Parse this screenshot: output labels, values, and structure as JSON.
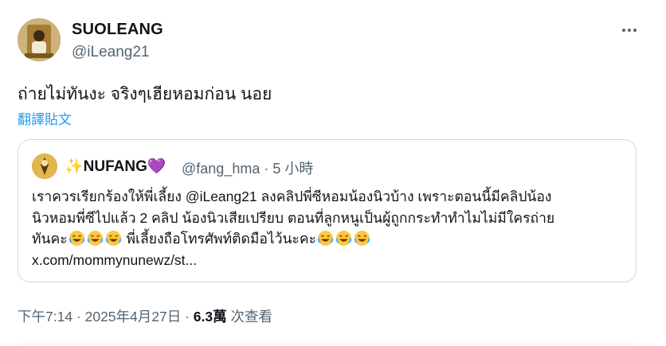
{
  "author": {
    "name": "SUOLEANG",
    "handle": "@iLeang21"
  },
  "tweet": {
    "text": "ถ่ายไม่ทันงะ จริงๆเฮียหอมก่อน นอย",
    "translate_label": "翻譯貼文"
  },
  "quote": {
    "name_prefix": "✨",
    "name": "NUFANG",
    "name_suffix": "💜",
    "handle_time": "@fang_hma · 5 小時",
    "line1": "เราควรเรียกร้องให้พี่เลี้ยง @iLeang21  ลงคลิปพี่ซีหอมน้องนิวบ้าง เพราะตอนนี้มีคลิปน้อง",
    "line2": "นิวหอมพี่ซีไปแล้ว 2 คลิป น้องนิวเสียเปรียบ ตอนที่ลูกหนูเป็นผู้ถูกกระทำทำไมไม่มีใครถ่าย",
    "line3_a": "ทันคะ",
    "line3_b": " พี่เลี้ยงถือโทรศัพท์ติดมือไว้นะคะ",
    "link": "x.com/mommynunewz/st..."
  },
  "meta": {
    "time_date": "下午7:14 · 2025年4月27日 · ",
    "views_count": "6.3萬",
    "views_label": " 次查看"
  },
  "icons": {
    "more": "more-horizontal-icon",
    "emoji": "face-with-tears-of-joy"
  },
  "colors": {
    "link": "#1d9bf0",
    "secondary_text": "#536471",
    "border": "#cfd9de"
  }
}
